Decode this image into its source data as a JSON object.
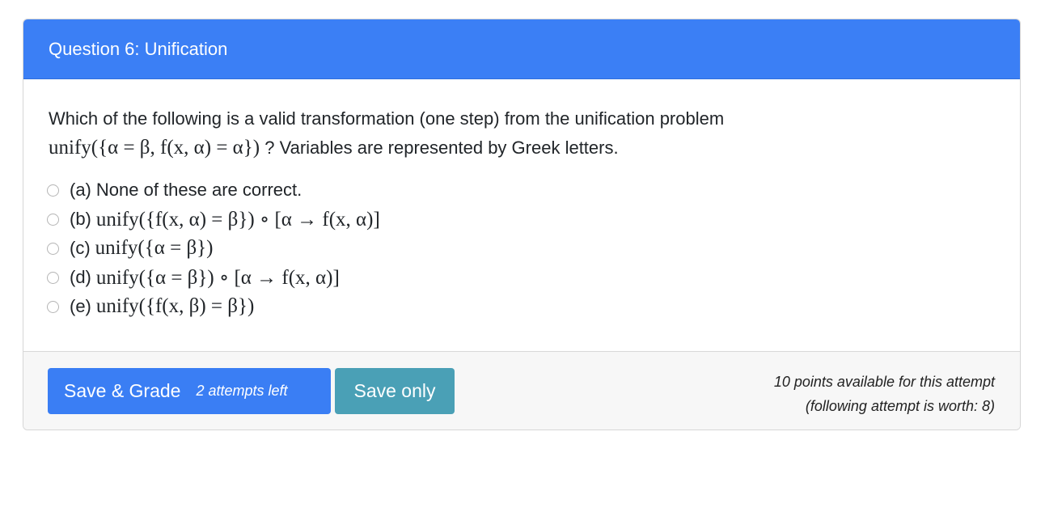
{
  "header": {
    "title": "Question 6: Unification"
  },
  "question": {
    "text_before": "Which of the following is a valid transformation (one step) from the unification problem",
    "math_problem": "unify({α = β, f(x, α) = α})",
    "text_after": " ? Variables are represented by Greek letters."
  },
  "options": [
    {
      "label": "(a)",
      "text": "None of these are correct.",
      "math": ""
    },
    {
      "label": "(b)",
      "text": "",
      "math": "unify({f(x, α) = β}) ∘ [α → f(x, α)]"
    },
    {
      "label": "(c)",
      "text": "",
      "math": "unify({α = β})"
    },
    {
      "label": "(d)",
      "text": "",
      "math": "unify({α = β}) ∘ [α → f(x, α)]"
    },
    {
      "label": "(e)",
      "text": "",
      "math": "unify({f(x, β) = β})"
    }
  ],
  "footer": {
    "grade_button_label": "Save & Grade",
    "attempts_left": "2 attempts left",
    "save_button_label": "Save only",
    "points_line1": "10 points available for this attempt",
    "points_line2": "(following attempt is worth: 8)"
  },
  "colors": {
    "header_bg": "#3b7ff5",
    "grade_button": "#3a7ef4",
    "save_button": "#4aa0b6"
  }
}
